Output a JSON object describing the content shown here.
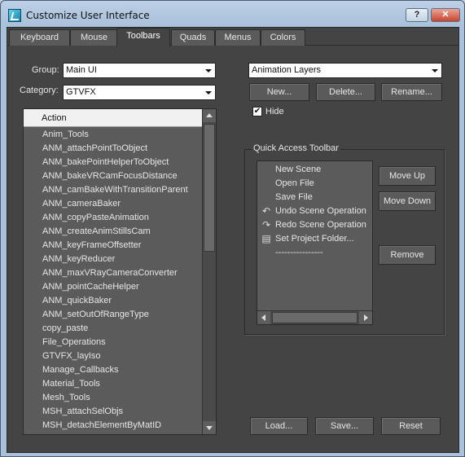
{
  "window": {
    "title": "Customize User Interface",
    "help_label": "?",
    "close_label": "✕"
  },
  "tabs": [
    {
      "label": "Keyboard",
      "active": false
    },
    {
      "label": "Mouse",
      "active": false
    },
    {
      "label": "Toolbars",
      "active": true
    },
    {
      "label": "Quads",
      "active": false
    },
    {
      "label": "Menus",
      "active": false
    },
    {
      "label": "Colors",
      "active": false
    }
  ],
  "left_panel": {
    "group_label": "Group:",
    "group_value": "Main UI",
    "category_label": "Category:",
    "category_value": "GTVFX",
    "action_header": "Action",
    "actions": [
      "Anim_Tools",
      "ANM_attachPointToObject",
      "ANM_bakePointHelperToObject",
      "ANM_bakeVRCamFocusDistance",
      "ANM_camBakeWithTransitionParent",
      "ANM_cameraBaker",
      "ANM_copyPasteAnimation",
      "ANM_createAnimStillsCam",
      "ANM_keyFrameOffsetter",
      "ANM_keyReducer",
      "ANM_maxVRayCameraConverter",
      "ANM_pointCacheHelper",
      "ANM_quickBaker",
      "ANM_setOutOfRangeType",
      "copy_paste",
      "File_Operations",
      "GTVFX_layIso",
      "Manage_Callbacks",
      "Material_Tools",
      "Mesh_Tools",
      "MSH_attachSelObjs",
      "MSH_detachElementByMatID"
    ]
  },
  "right_panel": {
    "toolbar_value": "Animation Layers",
    "new_label": "New...",
    "delete_label": "Delete...",
    "rename_label": "Rename...",
    "hide_label": "Hide",
    "hide_checked": "✔",
    "qat_title": "Quick Access Toolbar",
    "qat_items": [
      {
        "label": "New Scene",
        "icon": ""
      },
      {
        "label": "Open File",
        "icon": ""
      },
      {
        "label": "Save File",
        "icon": ""
      },
      {
        "label": "Undo Scene Operation",
        "icon": "↶"
      },
      {
        "label": "Redo Scene Operation",
        "icon": "↷"
      },
      {
        "label": "Set Project Folder...",
        "icon": "▤"
      },
      {
        "label": "----------------",
        "icon": ""
      }
    ],
    "move_up_label": "Move Up",
    "move_down_label": "Move Down",
    "remove_label": "Remove"
  },
  "footer": {
    "load_label": "Load...",
    "save_label": "Save...",
    "reset_label": "Reset"
  }
}
